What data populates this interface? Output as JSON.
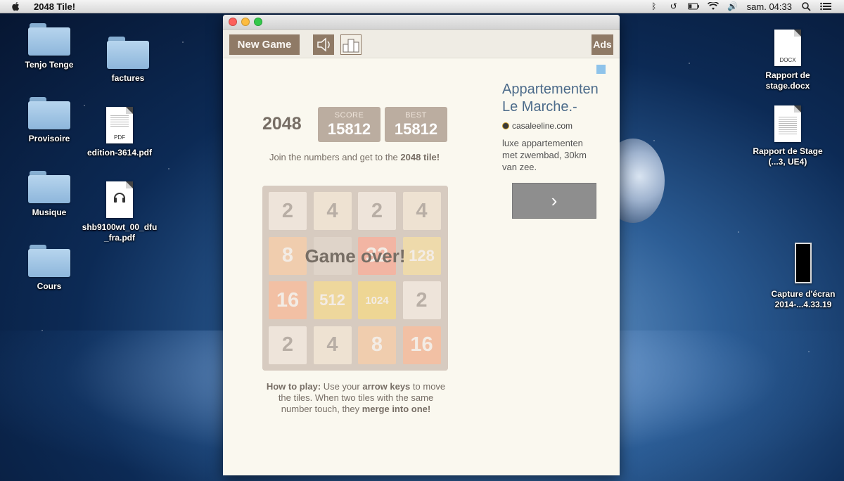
{
  "menubar": {
    "app_name": "2048 Tile!",
    "clock": "sam. 04:33"
  },
  "desktop": {
    "folders": [
      {
        "label": "Tenjo Tenge"
      },
      {
        "label": "factures"
      },
      {
        "label": "Provisoire"
      },
      {
        "label": "Musique"
      },
      {
        "label": "Cours"
      }
    ],
    "files": [
      {
        "label": "edition-3614.pdf",
        "kind": "PDF"
      },
      {
        "label": "shb9100wt_00_dfu_fra.pdf"
      },
      {
        "label": "Rapport de stage.docx",
        "kind": "DOCX"
      },
      {
        "label": "Rapport de Stage (...3, UE4)"
      },
      {
        "label": "Capture d'écran 2014-...4.33.19"
      }
    ]
  },
  "toolbar": {
    "new_game_label": "New Game",
    "ads_label": "Ads"
  },
  "game": {
    "title": "2048",
    "score_label": "SCORE",
    "score": "15812",
    "best_label": "BEST",
    "best": "15812",
    "intro_text": "Join the numbers and get to the ",
    "intro_bold": "2048 tile!",
    "game_over": "Game over!",
    "grid": [
      [
        "2",
        "4",
        "2",
        "4"
      ],
      [
        "8",
        "",
        "32",
        "128"
      ],
      [
        "16",
        "512",
        "1024",
        "2"
      ],
      [
        "2",
        "4",
        "8",
        "16"
      ]
    ],
    "howto_bold": "How to play:",
    "howto_1": " Use your ",
    "howto_keys": "arrow keys",
    "howto_2": " to move the tiles. When two tiles with the same number touch, they ",
    "howto_merge": "merge into one!"
  },
  "ad": {
    "title": "Appartementen Le Marche.-",
    "domain": "casaleeline.com",
    "description": "luxe appartementen met zwembad, 30km van zee.",
    "cta_symbol": "›"
  },
  "colors": {
    "tile_2": "#eee4da",
    "tile_4": "#ede0c8",
    "tile_8": "#f2b179",
    "tile_16": "#f59563",
    "tile_32": "#f67c5f",
    "tile_128": "#edcf72",
    "tile_512": "#edc850",
    "tile_1024": "#edc53f",
    "board": "#bbada0",
    "button": "#8f7a66"
  }
}
